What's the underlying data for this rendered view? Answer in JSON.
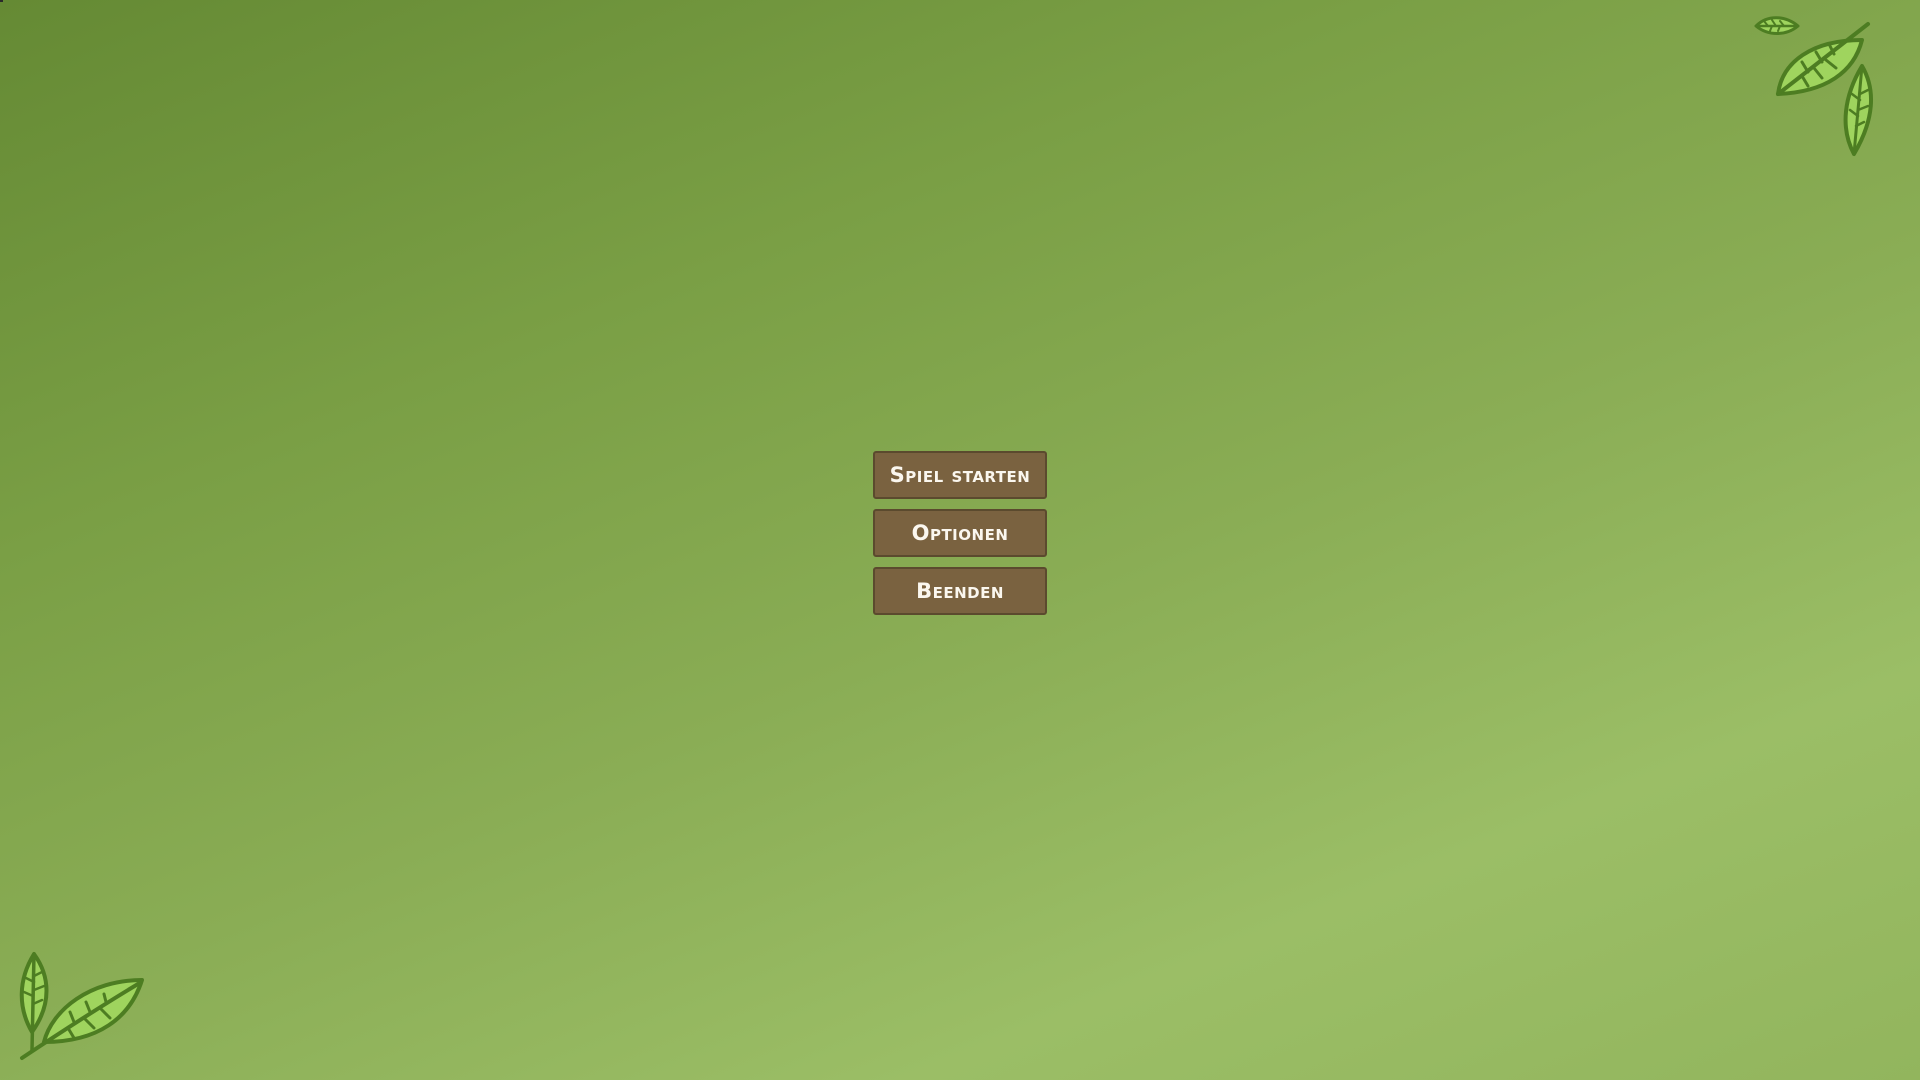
{
  "menu": {
    "start_label": "Spiel starten",
    "options_label": "Optionen",
    "quit_label": "Beenden"
  },
  "colors": {
    "background_dark": "#658a34",
    "background_light": "#9bbe66",
    "button_fill": "#7a6240",
    "button_border": "#5b4a2e",
    "button_text": "#fbf7ef",
    "leaf_fill": "#9fd45e",
    "leaf_outline": "#4d7d22"
  },
  "decorations": {
    "top_right": "leaf-cluster-icon",
    "bottom_left": "leaf-cluster-icon"
  }
}
